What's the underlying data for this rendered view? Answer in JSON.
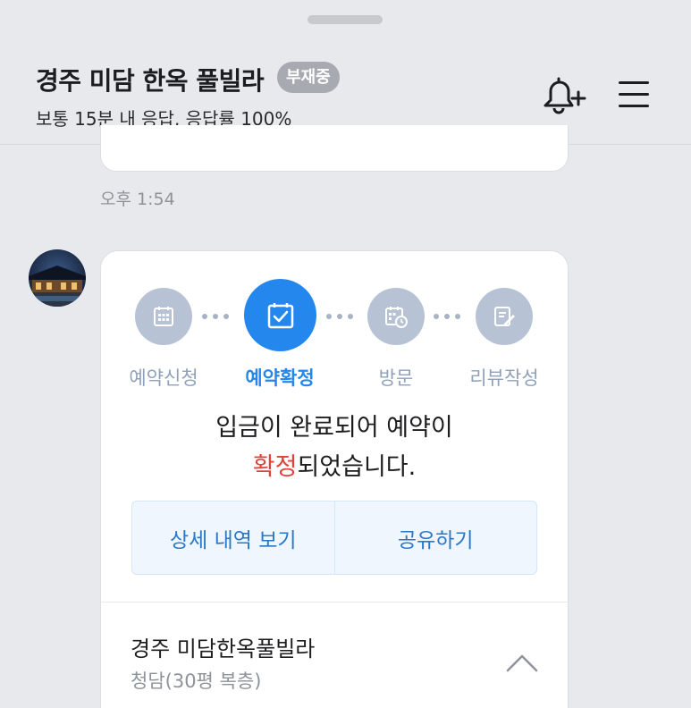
{
  "header": {
    "title": "경주 미담 한옥 풀빌라",
    "status_badge": "부재중",
    "subtitle": "보통 15분 내 응답, 응답률 100%",
    "icons": [
      "bell-plus-icon",
      "hamburger-menu-icon"
    ]
  },
  "chat": {
    "timestamp": "오후 1:54"
  },
  "reservation_card": {
    "steps": [
      {
        "label": "예약신청",
        "icon": "calendar-icon",
        "active": false
      },
      {
        "label": "예약확정",
        "icon": "calendar-check-icon",
        "active": true
      },
      {
        "label": "방문",
        "icon": "calendar-clock-icon",
        "active": false
      },
      {
        "label": "리뷰작성",
        "icon": "edit-note-icon",
        "active": false
      }
    ],
    "message_line1": "입금이 완료되어 예약이",
    "message_highlight": "확정",
    "message_rest": "되었습니다.",
    "buttons": {
      "details": "상세 내역 보기",
      "share": "공유하기"
    },
    "property": {
      "name": "경주 미담한옥풀빌라",
      "room": "청담(30평 복층)"
    }
  },
  "colors": {
    "accent": "#2387ee",
    "highlight_red": "#e0433a",
    "inactive_step": "#b7c3d5"
  }
}
